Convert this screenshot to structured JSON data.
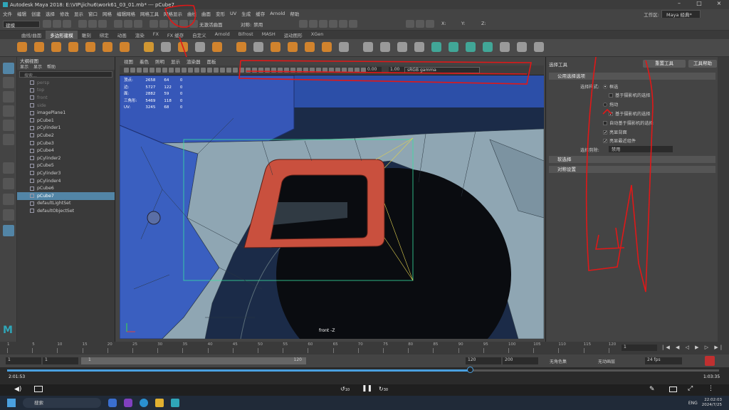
{
  "window": {
    "title": "Autodesk Maya 2018: E:\\VIP\\jichu6\\work61_03_01.mb*  ---  pCube7"
  },
  "menubar": [
    "文件",
    "编辑",
    "创建",
    "选择",
    "修改",
    "显示",
    "窗口",
    "网格",
    "编辑网格",
    "网格工具",
    "网格显示",
    "曲线",
    "曲面",
    "变形",
    "UV",
    "生成",
    "缓存",
    "Arnold",
    "帮助"
  ],
  "workspace": {
    "label": "工作区:",
    "value": "Maya 经典*"
  },
  "statusline": {
    "mode": "建模",
    "live": "无激活曲面",
    "symmetry_label": "对称:",
    "symmetry_value": "禁用",
    "x": "X:",
    "y": "Y:",
    "z": "Z:"
  },
  "shelf_tabs": [
    "曲线/曲面",
    "多边形建模",
    "雕刻",
    "绑定",
    "动画",
    "渲染",
    "FX",
    "FX 缓存",
    "自定义",
    "Arnold",
    "Bifrost",
    "MASH",
    "运动图形",
    "XGen"
  ],
  "shelf_active": 1,
  "outliner": {
    "title": "大纲视图",
    "menu": [
      "显示",
      "显示",
      "帮助"
    ],
    "search_placeholder": "搜索...",
    "items": [
      {
        "name": "persp",
        "dim": true
      },
      {
        "name": "top",
        "dim": true
      },
      {
        "name": "front",
        "dim": true
      },
      {
        "name": "side",
        "dim": true
      },
      {
        "name": "imagePlane1",
        "dim": false
      },
      {
        "name": "pCube1",
        "dim": false
      },
      {
        "name": "pCylinder1",
        "dim": false
      },
      {
        "name": "pCube2",
        "dim": false
      },
      {
        "name": "pCube3",
        "dim": false
      },
      {
        "name": "pCube4",
        "dim": false
      },
      {
        "name": "pCylinder2",
        "dim": false
      },
      {
        "name": "pCube5",
        "dim": false
      },
      {
        "name": "pCylinder3",
        "dim": false
      },
      {
        "name": "pCylinder4",
        "dim": false
      },
      {
        "name": "pCube6",
        "dim": false
      },
      {
        "name": "pCube7",
        "dim": false,
        "selected": true
      },
      {
        "name": "defaultLightSet",
        "dim": false
      },
      {
        "name": "defaultObjectSet",
        "dim": false
      }
    ]
  },
  "viewport": {
    "menu": [
      "视图",
      "着色",
      "照明",
      "显示",
      "渲染器",
      "面板"
    ],
    "exposure": "0.00",
    "gamma": "1.00",
    "colorspace": "sRGB gamma",
    "camera_label": "front -Z",
    "hud": [
      {
        "k": "顶点:",
        "a": "2658",
        "b": "64",
        "c": "0"
      },
      {
        "k": "边:",
        "a": "5727",
        "b": "122",
        "c": "0"
      },
      {
        "k": "面:",
        "a": "2882",
        "b": "59",
        "c": "0"
      },
      {
        "k": "三角形:",
        "a": "5469",
        "b": "118",
        "c": "0"
      },
      {
        "k": "UV:",
        "a": "3245",
        "b": "68",
        "c": "0"
      }
    ]
  },
  "tool_settings": {
    "title": "选择工具",
    "reset_label": "重置工具",
    "help_label": "工具帮助",
    "section_common": "公用选择选项",
    "style_label": "选择样式:",
    "style_marquee": "框选",
    "camera_based_1": "基于摄影机的选择",
    "style_drag": "拖动",
    "camera_based_2": "基于摄影机的选择",
    "auto_camera": "自动基于摄影机的选择",
    "highlight_back": "亮显背面",
    "highlight_nearest": "亮显最近组件",
    "select_by_label": "选择剪除:",
    "select_by_value": "禁用",
    "soft_select": "软选择",
    "symmetry_settings": "对称设置"
  },
  "time_slider": {
    "ticks": [
      "1",
      "5",
      "10",
      "15",
      "20",
      "25",
      "30",
      "35",
      "40",
      "45",
      "50",
      "55",
      "60",
      "65",
      "70",
      "75",
      "80",
      "85",
      "90",
      "95",
      "100",
      "105",
      "110",
      "115",
      "120"
    ],
    "current": "1"
  },
  "range": {
    "start": "1",
    "inner_start": "1",
    "inner_end": "120",
    "end_a": "120",
    "end_b": "200",
    "char_set": "无角色集",
    "anim_layer": "无动画层",
    "fps": "24 fps"
  },
  "video": {
    "elapsed": "2:01:53",
    "total": "1:03:35",
    "progress": 0.65,
    "back_label": "10",
    "fwd_label": "30"
  },
  "taskbar": {
    "search": "搜索",
    "time": "22:02:03",
    "date": "2024/7/25",
    "lang": "ENG"
  },
  "colors": {
    "accent": "#5285a6",
    "annotation": "#e01818",
    "red_part": "#c9503e",
    "blue_part": "#3a5fc0",
    "frame": "#8fa6b3"
  }
}
